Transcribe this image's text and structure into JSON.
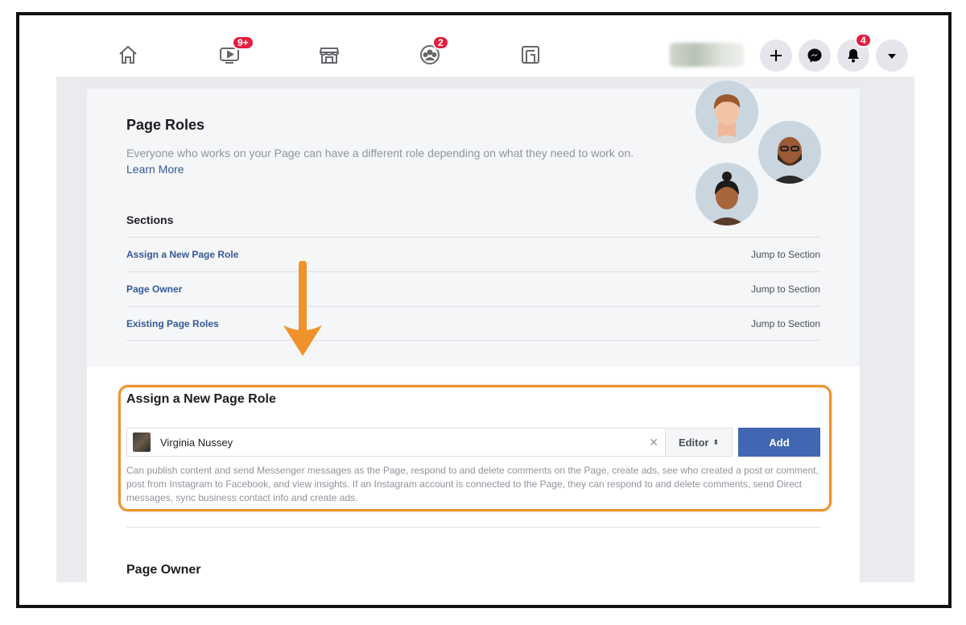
{
  "nav": {
    "video_badge": "9+",
    "groups_badge": "2",
    "notifications_badge": "4"
  },
  "page_roles": {
    "title": "Page Roles",
    "description": "Everyone who works on your Page can have a different role depending on what they need to work on.",
    "learn_more": "Learn More"
  },
  "sections": {
    "title": "Sections",
    "items": [
      {
        "label": "Assign a New Page Role",
        "jump": "Jump to Section"
      },
      {
        "label": "Page Owner",
        "jump": "Jump to Section"
      },
      {
        "label": "Existing Page Roles",
        "jump": "Jump to Section"
      }
    ]
  },
  "assign": {
    "title": "Assign a New Page Role",
    "name_value": "Virginia Nussey",
    "role_value": "Editor",
    "add_label": "Add",
    "role_description": "Can publish content and send Messenger messages as the Page, respond to and delete comments on the Page, create ads, see who created a post or comment, post from Instagram to Facebook, and view insights. If an Instagram account is connected to the Page, they can respond to and delete comments, send Direct messages, sync business contact info and create ads."
  },
  "page_owner": {
    "title": "Page Owner"
  },
  "colors": {
    "accent_blue": "#4267b2",
    "link_blue": "#365899",
    "badge_red": "#e41e3f",
    "highlight_orange": "#f0922b"
  }
}
